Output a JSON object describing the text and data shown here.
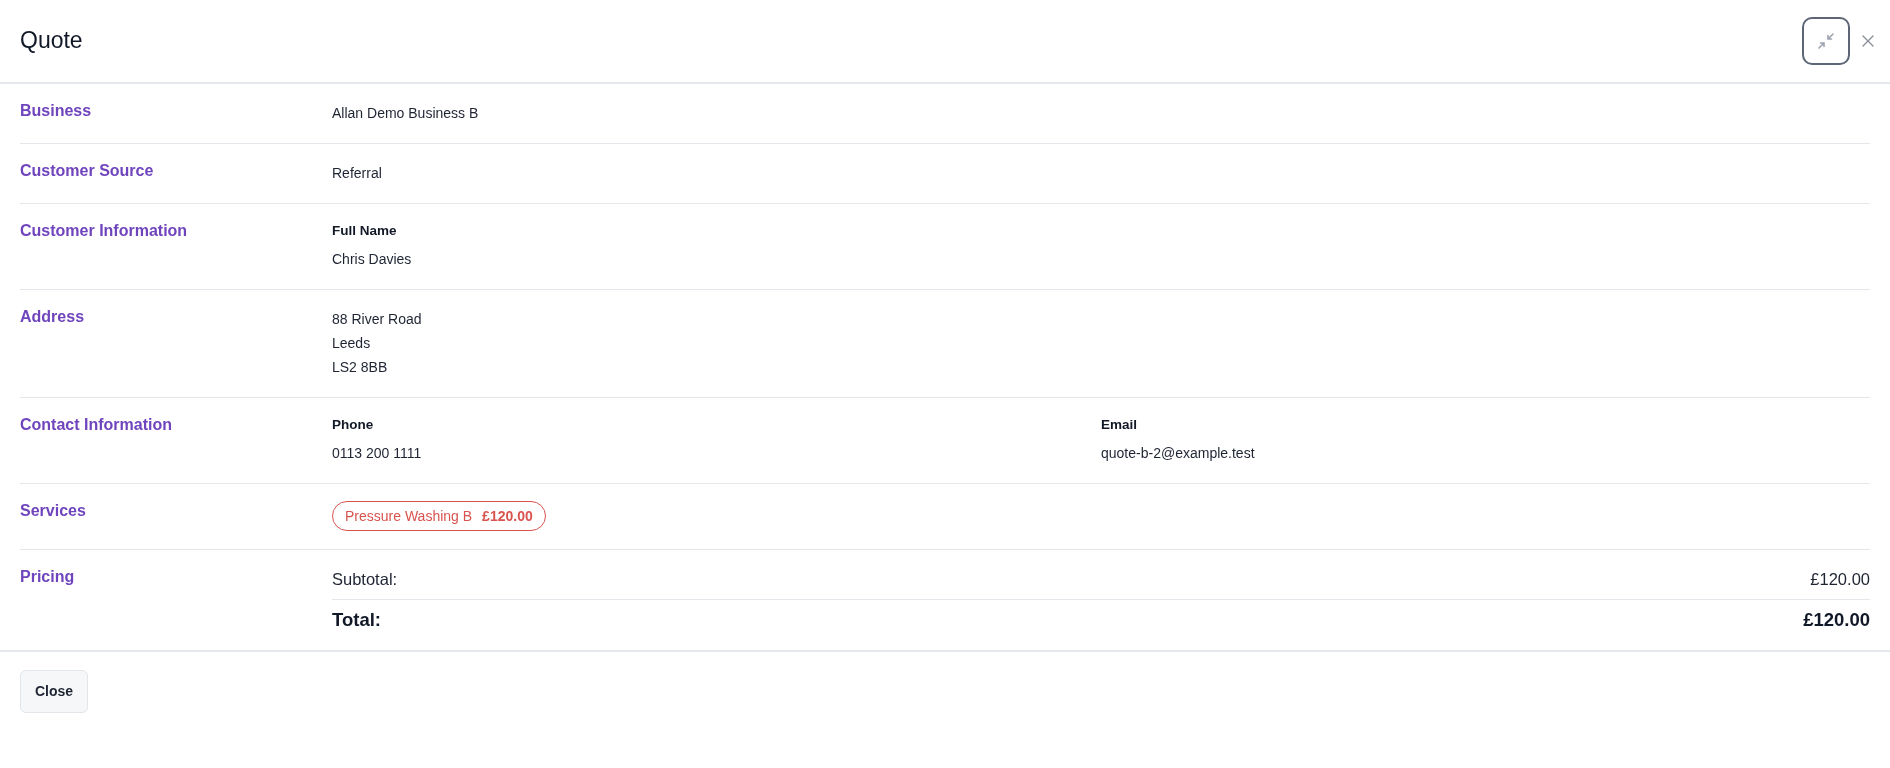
{
  "dialog": {
    "title": "Quote"
  },
  "sections": [
    {
      "label": "Business",
      "kind": "text",
      "value": "Allan Demo Business B"
    },
    {
      "label": "Customer Source",
      "kind": "text",
      "value": "Referral"
    },
    {
      "label": "Customer Information",
      "kind": "fields",
      "fields": [
        {
          "label": "Full Name",
          "value": "Chris Davies"
        }
      ]
    },
    {
      "label": "Address",
      "kind": "lines",
      "lines": [
        "88 River Road",
        "Leeds",
        "LS2 8BB"
      ]
    },
    {
      "label": "Contact Information",
      "kind": "fields",
      "fields": [
        {
          "label": "Phone",
          "value": "0113 200 1111"
        },
        {
          "label": "Email",
          "value": "quote-b-2@example.test"
        }
      ]
    },
    {
      "label": "Services",
      "kind": "services",
      "services": [
        {
          "name": "Pressure Washing B",
          "price": "£120.00"
        }
      ]
    },
    {
      "label": "Pricing",
      "kind": "pricing",
      "lines": [
        {
          "label": "Subtotal:",
          "amount": "£120.00",
          "kind": "subtotal"
        },
        {
          "label": "Total:",
          "amount": "£120.00",
          "kind": "total"
        }
      ]
    }
  ],
  "footer": {
    "close_button": "Close"
  }
}
